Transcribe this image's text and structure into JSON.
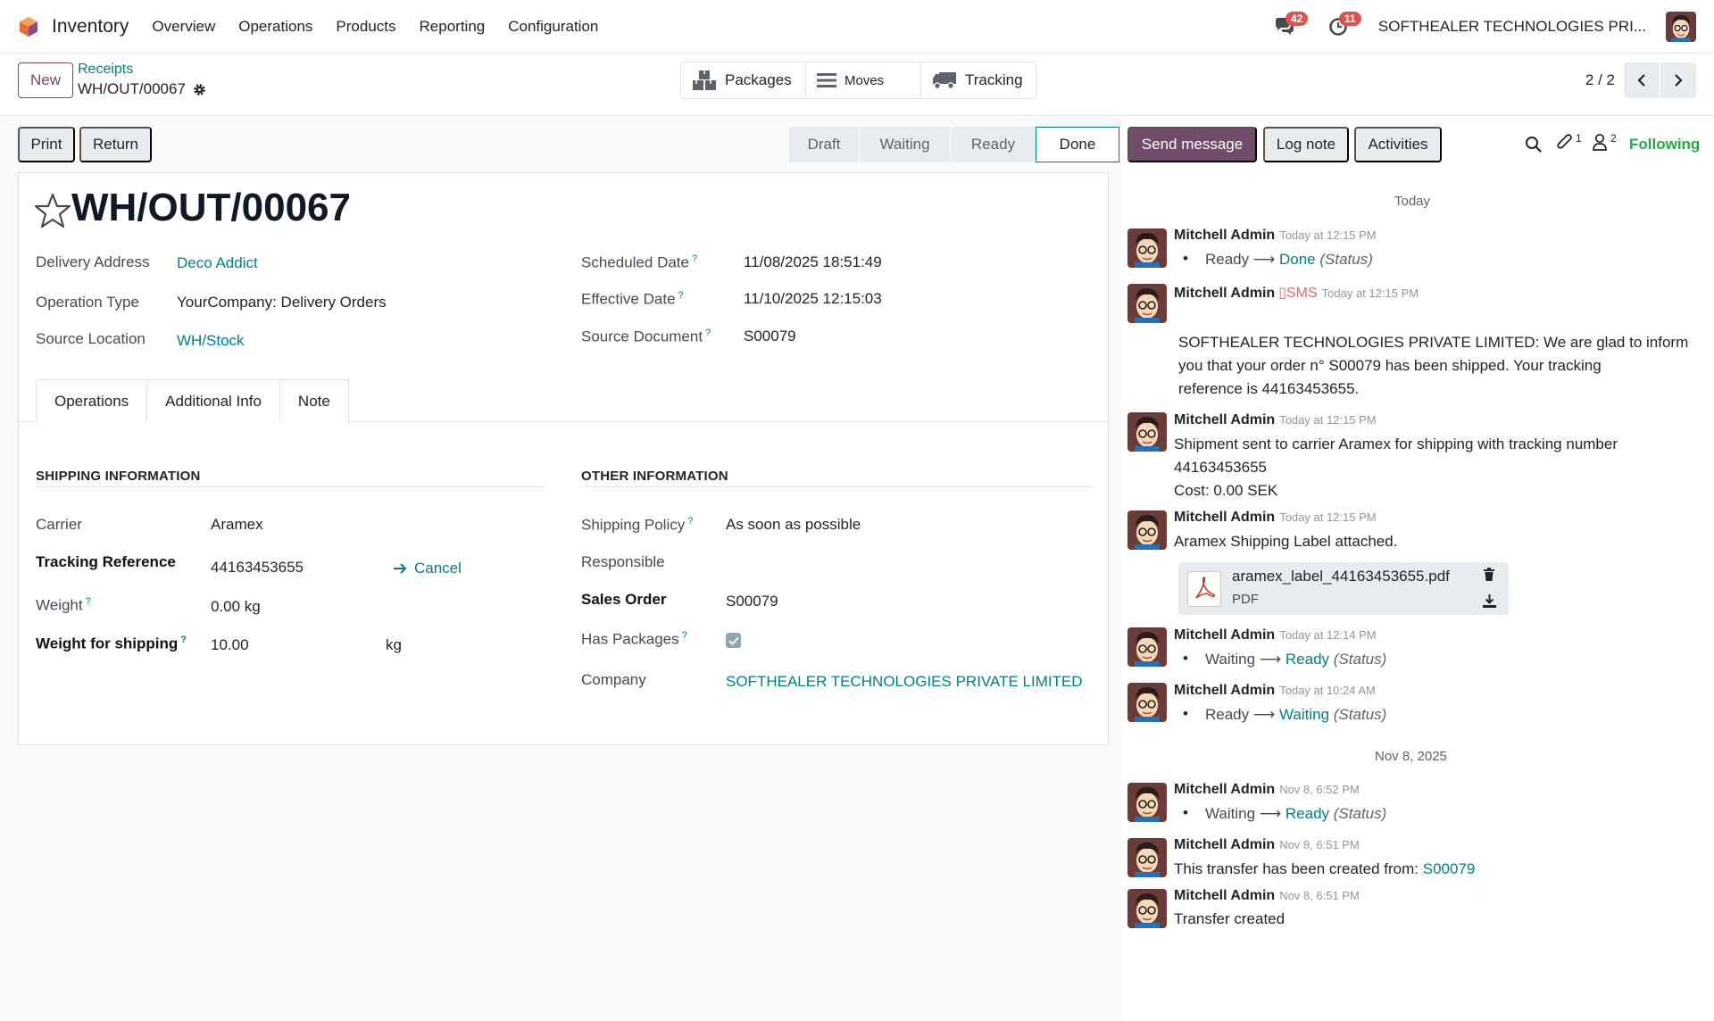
{
  "navbar": {
    "app_name": "Inventory",
    "menus": [
      "Overview",
      "Operations",
      "Products",
      "Reporting",
      "Configuration"
    ],
    "messages_count": "42",
    "activities_count": "11",
    "company": "SOFTHEALER TECHNOLOGIES PRI..."
  },
  "control": {
    "new_label": "New",
    "breadcrumb_parent": "Receipts",
    "breadcrumb_current": "WH/OUT/00067",
    "smart_buttons": {
      "packages": "Packages",
      "moves": "Moves",
      "tracking": "Tracking"
    },
    "pager": "2 / 2"
  },
  "actions": {
    "print": "Print",
    "return": "Return"
  },
  "status": {
    "steps": [
      "Draft",
      "Waiting",
      "Ready",
      "Done"
    ],
    "current": "Done"
  },
  "record": {
    "name": "WH/OUT/00067",
    "delivery_address_label": "Delivery Address",
    "delivery_address": "Deco Addict",
    "operation_type_label": "Operation Type",
    "operation_type": "YourCompany: Delivery Orders",
    "source_location_label": "Source Location",
    "source_location": "WH/Stock",
    "scheduled_date_label": "Scheduled Date",
    "scheduled_date": "11/08/2025 18:51:49",
    "effective_date_label": "Effective Date",
    "effective_date": "11/10/2025 12:15:03",
    "source_document_label": "Source Document",
    "source_document": "S00079"
  },
  "tabs": [
    "Operations",
    "Additional Info",
    "Note"
  ],
  "shipping": {
    "title": "SHIPPING INFORMATION",
    "carrier_label": "Carrier",
    "carrier": "Aramex",
    "tracking_label": "Tracking Reference",
    "tracking": "44163453655",
    "cancel_label": "Cancel",
    "weight_label": "Weight",
    "weight": "0.00 kg",
    "weight_ship_label": "Weight for shipping",
    "weight_ship": "10.00",
    "weight_ship_unit": "kg"
  },
  "other": {
    "title": "OTHER INFORMATION",
    "policy_label": "Shipping Policy",
    "policy": "As soon as possible",
    "responsible_label": "Responsible",
    "sales_order_label": "Sales Order",
    "sales_order": "S00079",
    "has_packages_label": "Has Packages",
    "company_label": "Company",
    "company": "SOFTHEALER TECHNOLOGIES PRIVATE LIMITED"
  },
  "chatter": {
    "send_message": "Send message",
    "log_note": "Log note",
    "activities": "Activities",
    "attachments_count": "1",
    "followers_count": "2",
    "following": "Following",
    "date_today": "Today",
    "date_nov8": "Nov 8, 2025",
    "messages": [
      {
        "author": "Mitchell Admin",
        "time": "Today at 12:15 PM",
        "old": "Ready",
        "new": "Done",
        "field": "(Status)"
      },
      {
        "author": "Mitchell Admin",
        "sms": "SMS",
        "time": "Today at 12:15 PM",
        "body": [
          "SOFTHEALER TECHNOLOGIES PRIVATE LIMITED: We are glad to inform",
          "you that your order n° S00079 has been shipped. Your tracking",
          "reference is 44163453655."
        ]
      },
      {
        "author": "Mitchell Admin",
        "time": "Today at 12:15 PM",
        "body": [
          "Shipment sent to carrier Aramex for shipping with tracking number",
          "44163453655",
          "Cost: 0.00 SEK"
        ]
      },
      {
        "author": "Mitchell Admin",
        "time": "Today at 12:15 PM",
        "body": [
          "Aramex Shipping Label attached."
        ],
        "attachment": {
          "name": "aramex_label_44163453655.pdf",
          "type": "PDF"
        }
      },
      {
        "author": "Mitchell Admin",
        "time": "Today at 12:14 PM",
        "old": "Waiting",
        "new": "Ready",
        "field": "(Status)"
      },
      {
        "author": "Mitchell Admin",
        "time": "Today at 10:24 AM",
        "old": "Ready",
        "new": "Waiting",
        "field": "(Status)"
      },
      {
        "author": "Mitchell Admin",
        "time": "Nov 8, 6:52 PM",
        "old": "Waiting",
        "new": "Ready",
        "field": "(Status)"
      },
      {
        "author": "Mitchell Admin",
        "time": "Nov 8, 6:51 PM",
        "body_prefix": "This transfer has been created from: ",
        "body_link": "S00079"
      },
      {
        "author": "Mitchell Admin",
        "time": "Nov 8, 6:51 PM",
        "body": [
          "Transfer created"
        ]
      }
    ]
  },
  "colors": {
    "brand": "#714b67",
    "link": "#017e84",
    "badge": "#d9534f"
  }
}
